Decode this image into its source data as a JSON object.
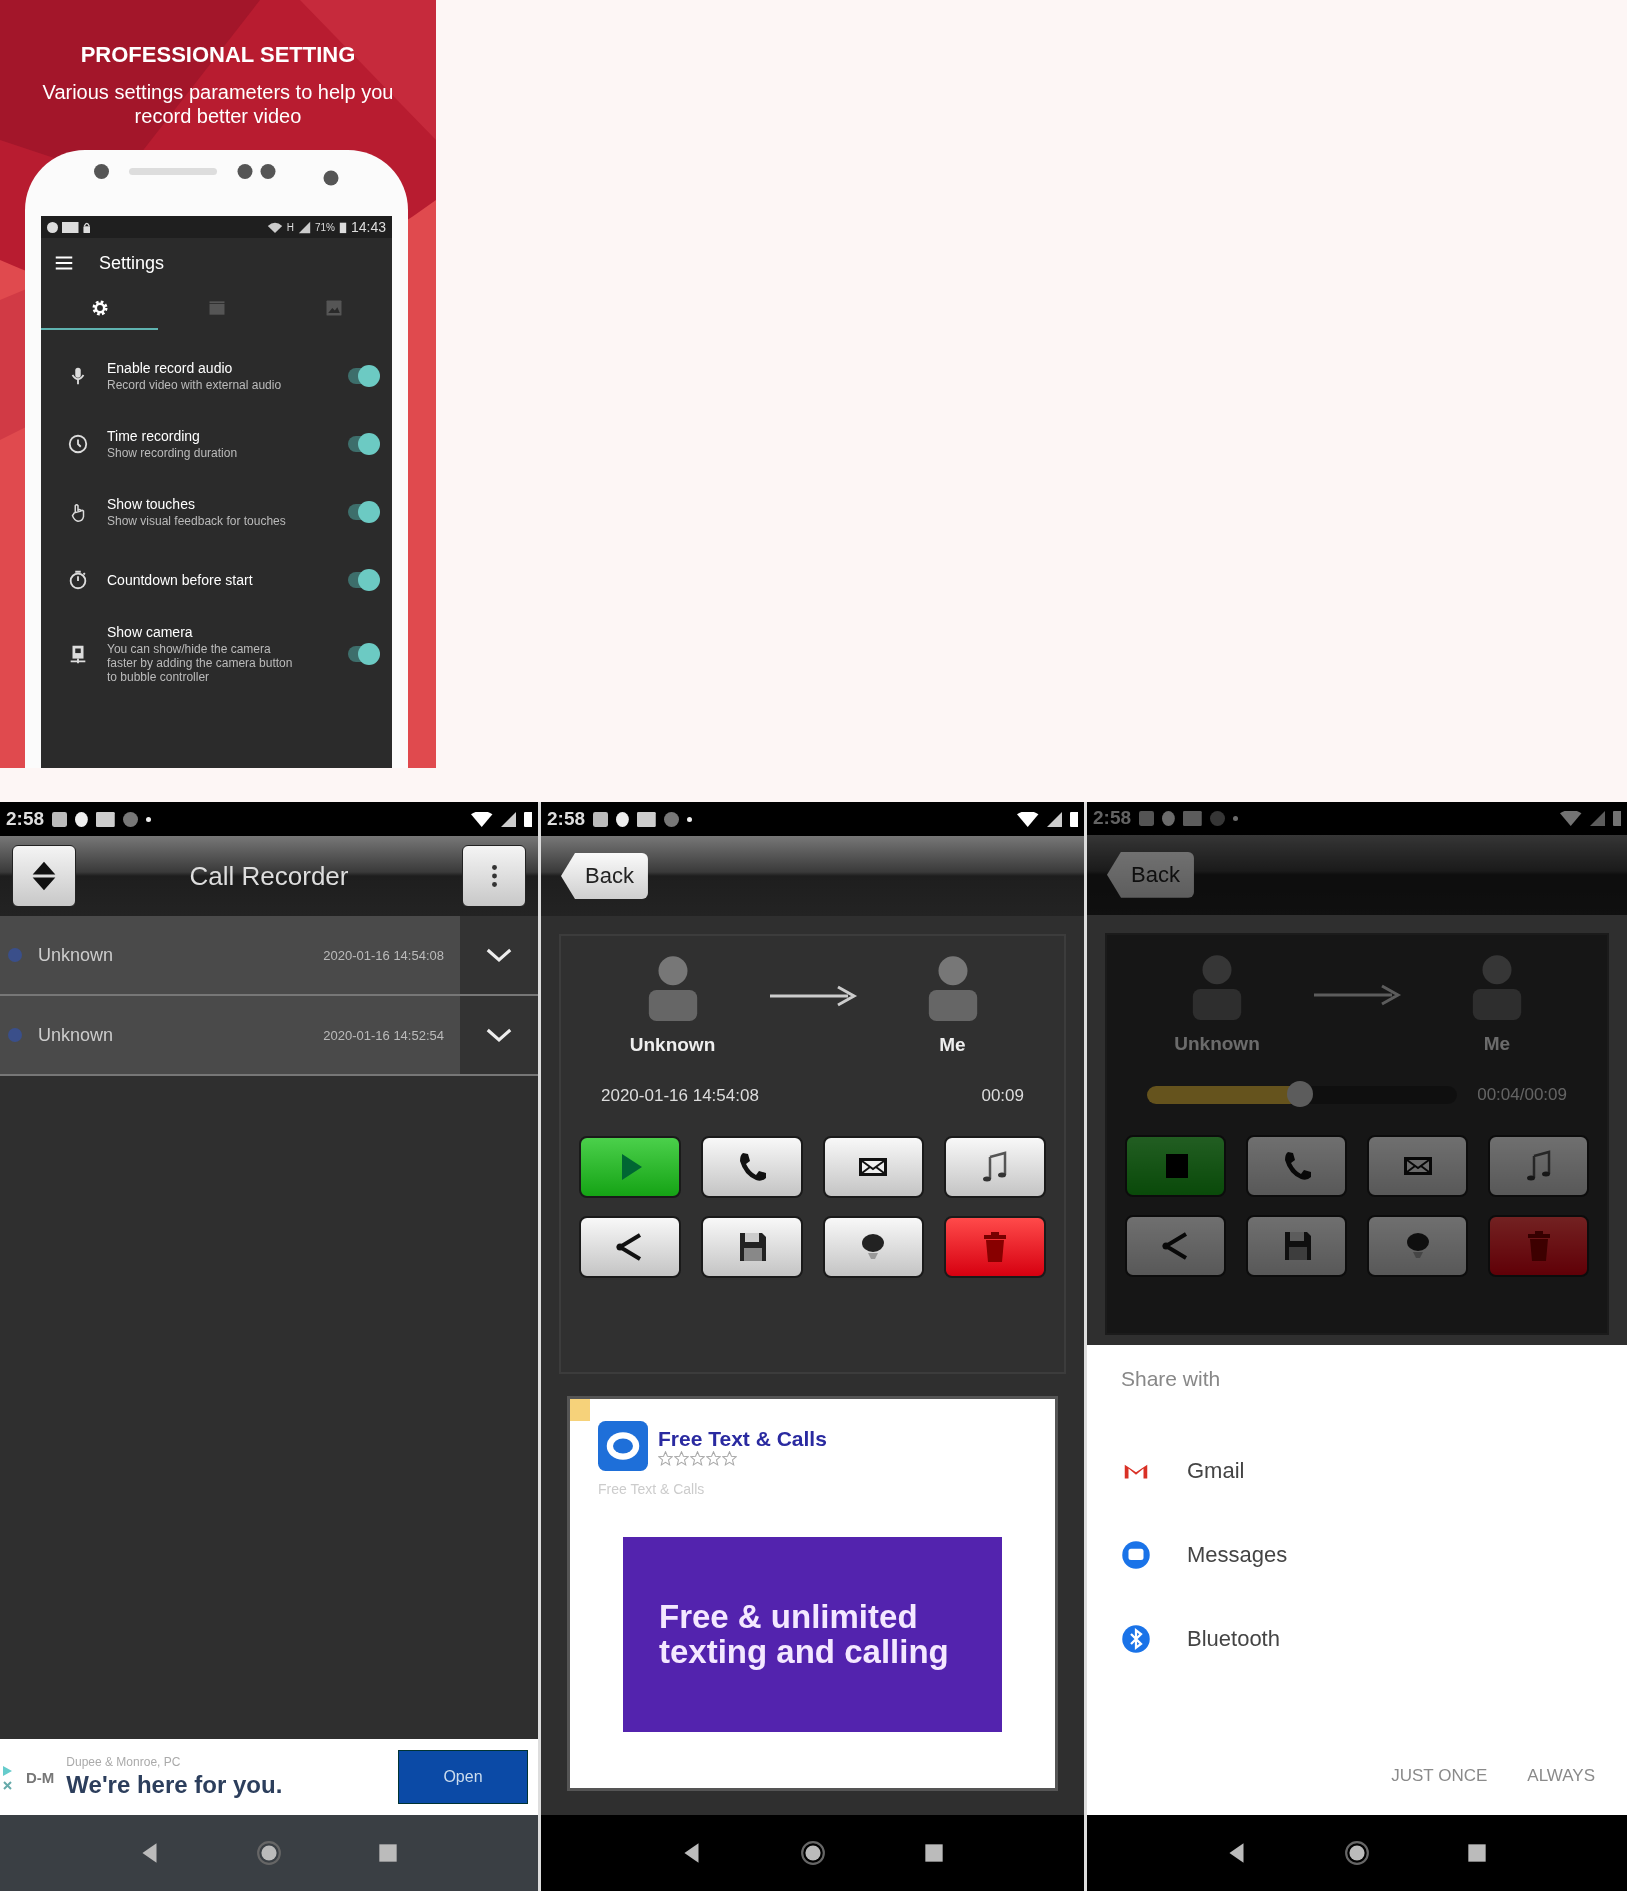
{
  "promo": {
    "title": "PROFESSIONAL SETTING",
    "subtitle": "Various settings parameters to help you record better video",
    "phone": {
      "status": {
        "network": "H",
        "battery": "71%",
        "time": "14:43"
      },
      "app_bar": {
        "title": "Settings"
      },
      "tabs": [
        {
          "selected": true
        },
        {
          "selected": false
        },
        {
          "selected": false
        }
      ],
      "settings": [
        {
          "title": "Enable record audio",
          "description": "Record video with external audio",
          "on": true
        },
        {
          "title": "Time recording",
          "description": "Show recording duration",
          "on": true
        },
        {
          "title": "Show touches",
          "description": "Show visual feedback for touches",
          "on": true
        },
        {
          "title": "Countdown before start",
          "on": true
        },
        {
          "title": "Show camera",
          "description": "You can show/hide the camera faster by adding the camera button to bubble controller",
          "on": true
        }
      ]
    }
  },
  "call_list_screen": {
    "status_time": "2:58",
    "app_bar": {
      "title": "Call Recorder"
    },
    "recordings": [
      {
        "name": "Unknown",
        "date": "2020-01-16 14:54:08"
      },
      {
        "name": "Unknown",
        "date": "2020-01-16 14:52:54"
      }
    ],
    "ad": {
      "advertiser": "Dupee & Monroe, PC",
      "logo": "D-M",
      "headline": "We're here for you.",
      "button": "Open"
    }
  },
  "playback_screen": {
    "status_time": "2:58",
    "back": "Back",
    "caller": "Unknown",
    "callee": "Me",
    "date": "2020-01-16 14:54:08",
    "duration": "00:09",
    "buttons": [
      {
        "kind": "play"
      },
      {
        "kind": "call"
      },
      {
        "kind": "mail"
      },
      {
        "kind": "music"
      },
      {
        "kind": "share"
      },
      {
        "kind": "save"
      },
      {
        "kind": "record"
      },
      {
        "kind": "delete"
      }
    ],
    "ad": {
      "app_name": "Free Text & Calls",
      "stars": 0,
      "subtitle": "Free Text & Calls",
      "banner": "Free & unlimited texting and calling"
    }
  },
  "sharing_screen": {
    "status_time": "2:58",
    "dimmed": true,
    "back": "Back",
    "caller": "Unknown",
    "callee": "Me",
    "progress": {
      "level": 0.49,
      "reading": "00:04/00:09"
    },
    "buttons": [
      {
        "kind": "stop"
      },
      {
        "kind": "call"
      },
      {
        "kind": "mail"
      },
      {
        "kind": "music"
      },
      {
        "kind": "share"
      },
      {
        "kind": "save"
      },
      {
        "kind": "record"
      },
      {
        "kind": "delete"
      }
    ],
    "share_sheet": {
      "title": "Share with",
      "targets": [
        {
          "label": "Gmail"
        },
        {
          "label": "Messages"
        },
        {
          "label": "Bluetooth"
        }
      ],
      "actions": [
        "JUST ONCE",
        "ALWAYS"
      ]
    }
  }
}
